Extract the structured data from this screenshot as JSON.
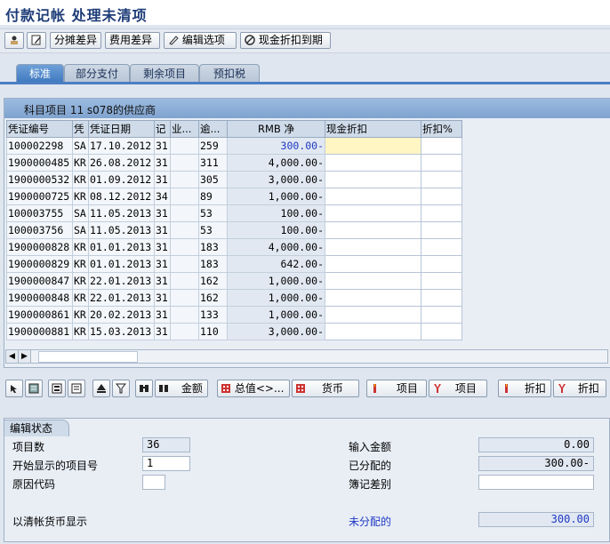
{
  "window": {
    "title": "付款记帐 处理未清项"
  },
  "toolbar": {
    "btn_distribute": "分摊差异",
    "btn_charge": "费用差异",
    "btn_edit_options": "编辑选项",
    "btn_cash_discount": "现金折扣到期"
  },
  "tabs": [
    {
      "label": "标准"
    },
    {
      "label": "部分支付"
    },
    {
      "label": "剩余项目"
    },
    {
      "label": "预扣税"
    }
  ],
  "panel": {
    "title": "科目项目 11 s078的供应商"
  },
  "table": {
    "headers": [
      "凭证编号",
      "凭",
      "凭证日期",
      "记",
      "业...",
      "逾...",
      "RMB 净",
      "现金折扣",
      "折扣%"
    ],
    "rows": [
      [
        "100002298",
        "SA",
        "17.10.2012",
        "31",
        "",
        "259",
        "300.00-",
        "",
        ""
      ],
      [
        "1900000485",
        "KR",
        "26.08.2012",
        "31",
        "",
        "311",
        "4,000.00-",
        "",
        ""
      ],
      [
        "1900000532",
        "KR",
        "01.09.2012",
        "31",
        "",
        "305",
        "3,000.00-",
        "",
        ""
      ],
      [
        "1900000725",
        "KR",
        "08.12.2012",
        "34",
        "",
        "89",
        "1,000.00-",
        "",
        ""
      ],
      [
        "100003755",
        "SA",
        "11.05.2013",
        "31",
        "",
        "53",
        "100.00-",
        "",
        ""
      ],
      [
        "100003756",
        "SA",
        "11.05.2013",
        "31",
        "",
        "53",
        "100.00-",
        "",
        ""
      ],
      [
        "1900000828",
        "KR",
        "01.01.2013",
        "31",
        "",
        "183",
        "4,000.00-",
        "",
        ""
      ],
      [
        "1900000829",
        "KR",
        "01.01.2013",
        "31",
        "",
        "183",
        "642.00-",
        "",
        ""
      ],
      [
        "1900000847",
        "KR",
        "22.01.2013",
        "31",
        "",
        "162",
        "1,000.00-",
        "",
        ""
      ],
      [
        "1900000848",
        "KR",
        "22.01.2013",
        "31",
        "",
        "162",
        "1,000.00-",
        "",
        ""
      ],
      [
        "1900000861",
        "KR",
        "20.02.2013",
        "31",
        "",
        "133",
        "1,000.00-",
        "",
        ""
      ],
      [
        "1900000881",
        "KR",
        "15.03.2013",
        "31",
        "",
        "110",
        "3,000.00-",
        "",
        ""
      ]
    ]
  },
  "buttons": {
    "amount": "金额",
    "total_value": "总值<>...",
    "currency": "货币",
    "item1": "项目",
    "item2": "项目",
    "discount1": "折扣",
    "discount2": "折扣"
  },
  "status": {
    "tab": "编辑状态",
    "item_count_label": "项目数",
    "item_count": "36",
    "first_item_label": "开始显示的项目号",
    "first_item": "1",
    "reason_label": "原因代码",
    "reason": "",
    "display_currency": "以清帐货币显示",
    "entered_label": "输入金额",
    "entered": "0.00",
    "assigned_label": "已分配的",
    "assigned": "300.00-",
    "posting_diff_label": "簿记差别",
    "posting_diff": "",
    "unassigned_label": "未分配的",
    "unassigned": "300.00"
  },
  "colors": {
    "title": "#1e3d78",
    "tab_active": "#3f78bf",
    "unassigned": "#1f39c4",
    "highlight": "#fff6c4"
  }
}
